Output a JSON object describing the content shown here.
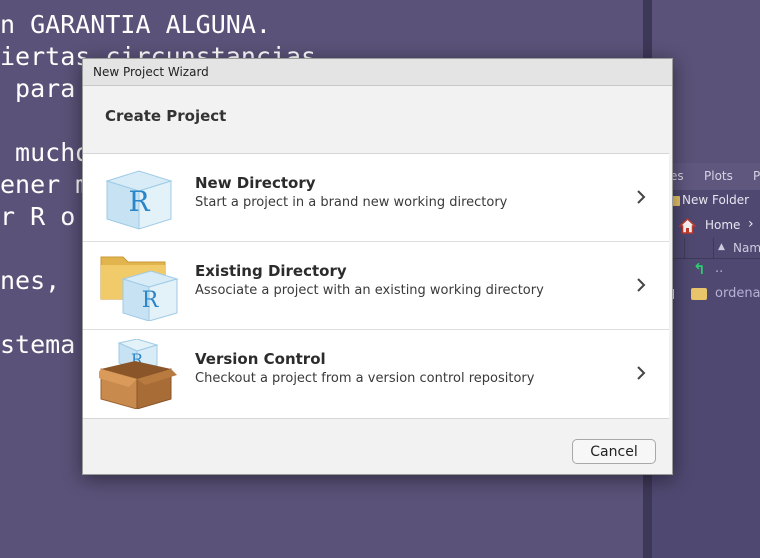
{
  "console": {
    "lines": [
      "n GARANTIA ALGUNA.",
      "iertas circunstancias",
      " para",
      " mucho",
      "ener m",
      "r R o",
      "nes, ",
      "stema"
    ]
  },
  "files_pane": {
    "tabs": [
      "es",
      "Plots",
      "P"
    ],
    "new_folder_label": "New Folder",
    "breadcrumb_home": "Home",
    "column_name": "Nam",
    "rows": [
      {
        "name": ".."
      },
      {
        "name": "ordena"
      }
    ]
  },
  "dialog": {
    "title": "New Project Wizard",
    "heading": "Create Project",
    "options": [
      {
        "title": "New Directory",
        "description": "Start a project in a brand new working directory",
        "icon": "r-cube-icon"
      },
      {
        "title": "Existing Directory",
        "description": "Associate a project with an existing working directory",
        "icon": "folder-r-icon"
      },
      {
        "title": "Version Control",
        "description": "Checkout a project from a version control repository",
        "icon": "box-r-icon"
      }
    ],
    "cancel_label": "Cancel"
  },
  "colors": {
    "console_bg": "#5a5278",
    "dialog_bg": "#f2f2f2",
    "accent_r": "#2b86c9"
  }
}
